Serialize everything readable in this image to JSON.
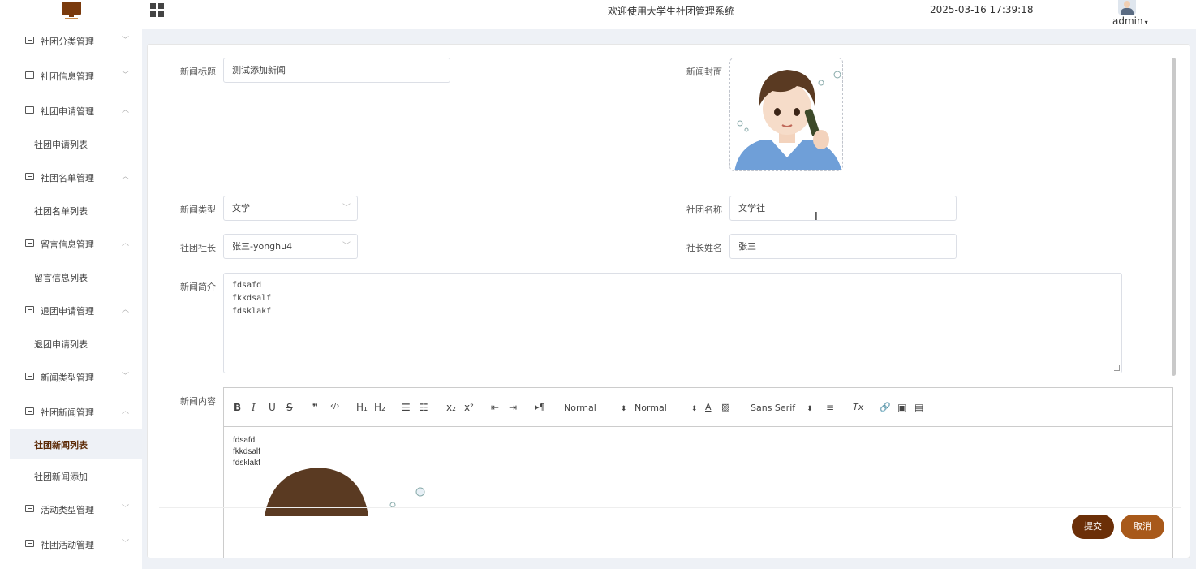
{
  "header": {
    "welcome": "欢迎使用大学生社团管理系统",
    "datetime": "2025-03-16 17:39:18",
    "username": "admin",
    "accent_color": "#6b2f08"
  },
  "sidebar": {
    "items": [
      {
        "label": "社团分类管理",
        "arrow": "﹀"
      },
      {
        "label": "社团信息管理",
        "arrow": "﹀"
      },
      {
        "label": "社团申请管理",
        "arrow": "︿",
        "sub": "社团申请列表"
      },
      {
        "label": "社团名单管理",
        "arrow": "︿",
        "sub": "社团名单列表"
      },
      {
        "label": "留言信息管理",
        "arrow": "︿",
        "sub": "留言信息列表"
      },
      {
        "label": "退团申请管理",
        "arrow": "︿",
        "sub": "退团申请列表"
      },
      {
        "label": "新闻类型管理",
        "arrow": "﹀"
      },
      {
        "label": "社团新闻管理",
        "arrow": "︿",
        "subs": [
          "社团新闻列表",
          "社团新闻添加"
        ]
      },
      {
        "label": "活动类型管理",
        "arrow": "﹀"
      },
      {
        "label": "社团活动管理",
        "arrow": "﹀"
      }
    ],
    "active_sub": "社团新闻列表"
  },
  "form": {
    "title_label": "新闻标题",
    "title_value": "测试添加新闻",
    "cover_label": "新闻封面",
    "type_label": "新闻类型",
    "type_value": "文学",
    "club_label": "社团名称",
    "club_value": "文学社",
    "leader_label": "社团社长",
    "leader_value": "张三-yonghu4",
    "leader_name_label": "社长姓名",
    "leader_name_value": "张三",
    "intro_label": "新闻简介",
    "intro_lines": [
      "fdsafd",
      "fkkdsalf",
      "fdsklakf"
    ],
    "content_label": "新闻内容",
    "content_lines": [
      "fdsafd",
      "fkkdsalf",
      "fdsklakf"
    ],
    "submit_label": "提交",
    "cancel_label": "取消"
  },
  "toolbar": {
    "bold": "B",
    "italic": "I",
    "underline": "U",
    "strike": "S",
    "quote": "❞",
    "code": "‹/›",
    "h1": "H₁",
    "h2": "H₂",
    "ordered": "☰",
    "bullet": "☷",
    "sub": "x₂",
    "sup": "x²",
    "outdent": "⇤",
    "indent": "⇥",
    "direction": "▸¶",
    "size": "Normal",
    "header": "Normal",
    "font": "Sans Serif",
    "color": "A",
    "background": "▨",
    "align": "≡",
    "clean": "Tx",
    "link": "🔗",
    "image": "▣",
    "video": "▤"
  }
}
